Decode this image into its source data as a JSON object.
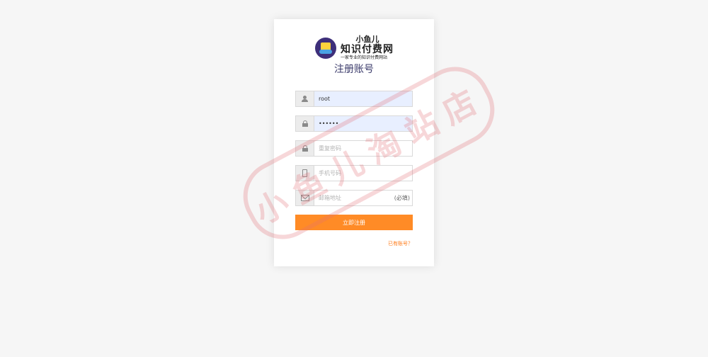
{
  "logo": {
    "line1": "小鱼儿",
    "line2": "知识付费网",
    "line3": "一家专业的知识付费网站"
  },
  "title": "注册账号",
  "fields": {
    "username": {
      "value": "root",
      "placeholder": "",
      "icon": "user-icon"
    },
    "password": {
      "value": "••••••",
      "placeholder": "",
      "icon": "lock-icon"
    },
    "confirm_password": {
      "value": "",
      "placeholder": "重复密码",
      "icon": "lock-icon"
    },
    "phone": {
      "value": "",
      "placeholder": "手机号码",
      "icon": "phone-icon"
    },
    "email": {
      "value": "",
      "placeholder": "邮箱地址",
      "hint": "(必填)",
      "icon": "mail-icon"
    }
  },
  "submit_label": "立即注册",
  "login_link": "已有账号？",
  "watermark": "小鱼儿淘站店",
  "colors": {
    "accent": "#ff8b26",
    "link": "#ff7a17",
    "autofill": "#e8efff"
  }
}
